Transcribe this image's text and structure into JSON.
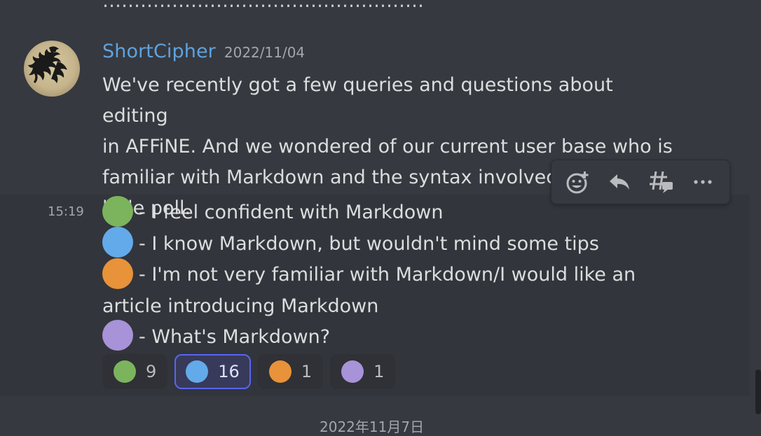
{
  "top_fragment": "……………………………………………",
  "message": {
    "username": "ShortCipher",
    "date": "2022/11/04",
    "lines": [
      "We've recently got a few queries and questions about editing",
      "in AFFiNE. And we wondered of our current user base who is",
      "familiar with Markdown and the syntax involved. So here's a",
      "little poll."
    ],
    "hover_time": "15:19",
    "poll_options": [
      {
        "color": "#7cb45d",
        "text": "- I feel confident with Markdown"
      },
      {
        "color": "#63aaea",
        "text": "- I know Markdown, but wouldn't mind some tips"
      },
      {
        "color": "#e8923a",
        "text": "- I'm not very familiar with Markdown/I would like an"
      },
      {
        "color": "#a892d8",
        "text": "- What's Markdown?"
      }
    ],
    "poll_option_3_continuation": "article introducing Markdown",
    "reactions": [
      {
        "color": "#7cb45d",
        "count": "9",
        "active": false
      },
      {
        "color": "#63aaea",
        "count": "16",
        "active": true
      },
      {
        "color": "#e8923a",
        "count": "1",
        "active": false
      },
      {
        "color": "#a892d8",
        "count": "1",
        "active": false
      }
    ]
  },
  "toolbar": {
    "add_reaction_icon": "emoji-add-icon",
    "reply_icon": "reply-icon",
    "thread_icon": "thread-icon",
    "more_icon": "more-icon"
  },
  "date_divider": "2022年11月7日"
}
